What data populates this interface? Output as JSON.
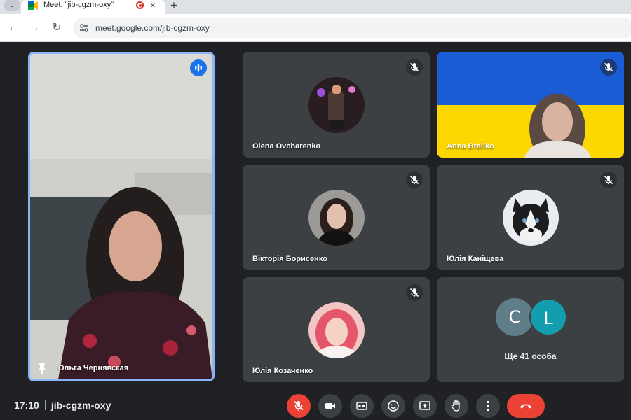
{
  "browser": {
    "tab_title": "Meet: \"jib-cgzm-oxy\"",
    "tab_close": "×",
    "new_tab": "+",
    "tab_list": "⌄",
    "url": "meet.google.com/jib-cgzm-oxy",
    "nav": {
      "back": "←",
      "forward": "→",
      "reload": "↻"
    }
  },
  "featured": {
    "name": "Ольга Чернявская",
    "pinned": true,
    "speaking": true
  },
  "participants": [
    {
      "name": "Olena Ovcharenko",
      "muted": true,
      "avatar": "photo"
    },
    {
      "name": "Anna Brailko",
      "muted": true,
      "background": "ukrainian-flag"
    },
    {
      "name": "Вікторія Борисенко",
      "muted": true,
      "avatar": "photo"
    },
    {
      "name": "Юлія Каніщева",
      "muted": true,
      "avatar": "husky-dog-photo"
    },
    {
      "name": "Юлія Козаченко",
      "muted": true,
      "avatar": "photo"
    }
  ],
  "more": {
    "initials": [
      "C",
      "L"
    ],
    "colors": [
      "#5f7e8a",
      "#129eaf"
    ],
    "label": "Ще 41 особа"
  },
  "meeting": {
    "time": "17:10",
    "code": "jib-cgzm-oxy"
  },
  "controls": [
    {
      "icon": "mic-off-icon",
      "state": "off"
    },
    {
      "icon": "camera-icon"
    },
    {
      "icon": "captions-icon"
    },
    {
      "icon": "emoji-icon"
    },
    {
      "icon": "present-screen-icon"
    },
    {
      "icon": "raise-hand-icon"
    },
    {
      "icon": "more-options-icon"
    },
    {
      "icon": "end-call-icon"
    }
  ],
  "colors": {
    "stage_bg": "#202124",
    "tile_bg": "#3c4043",
    "active_speaker_border": "#8ab4f8",
    "end_call": "#ea4335",
    "flag_blue": "#1a5bd6",
    "flag_yellow": "#fdd800"
  }
}
